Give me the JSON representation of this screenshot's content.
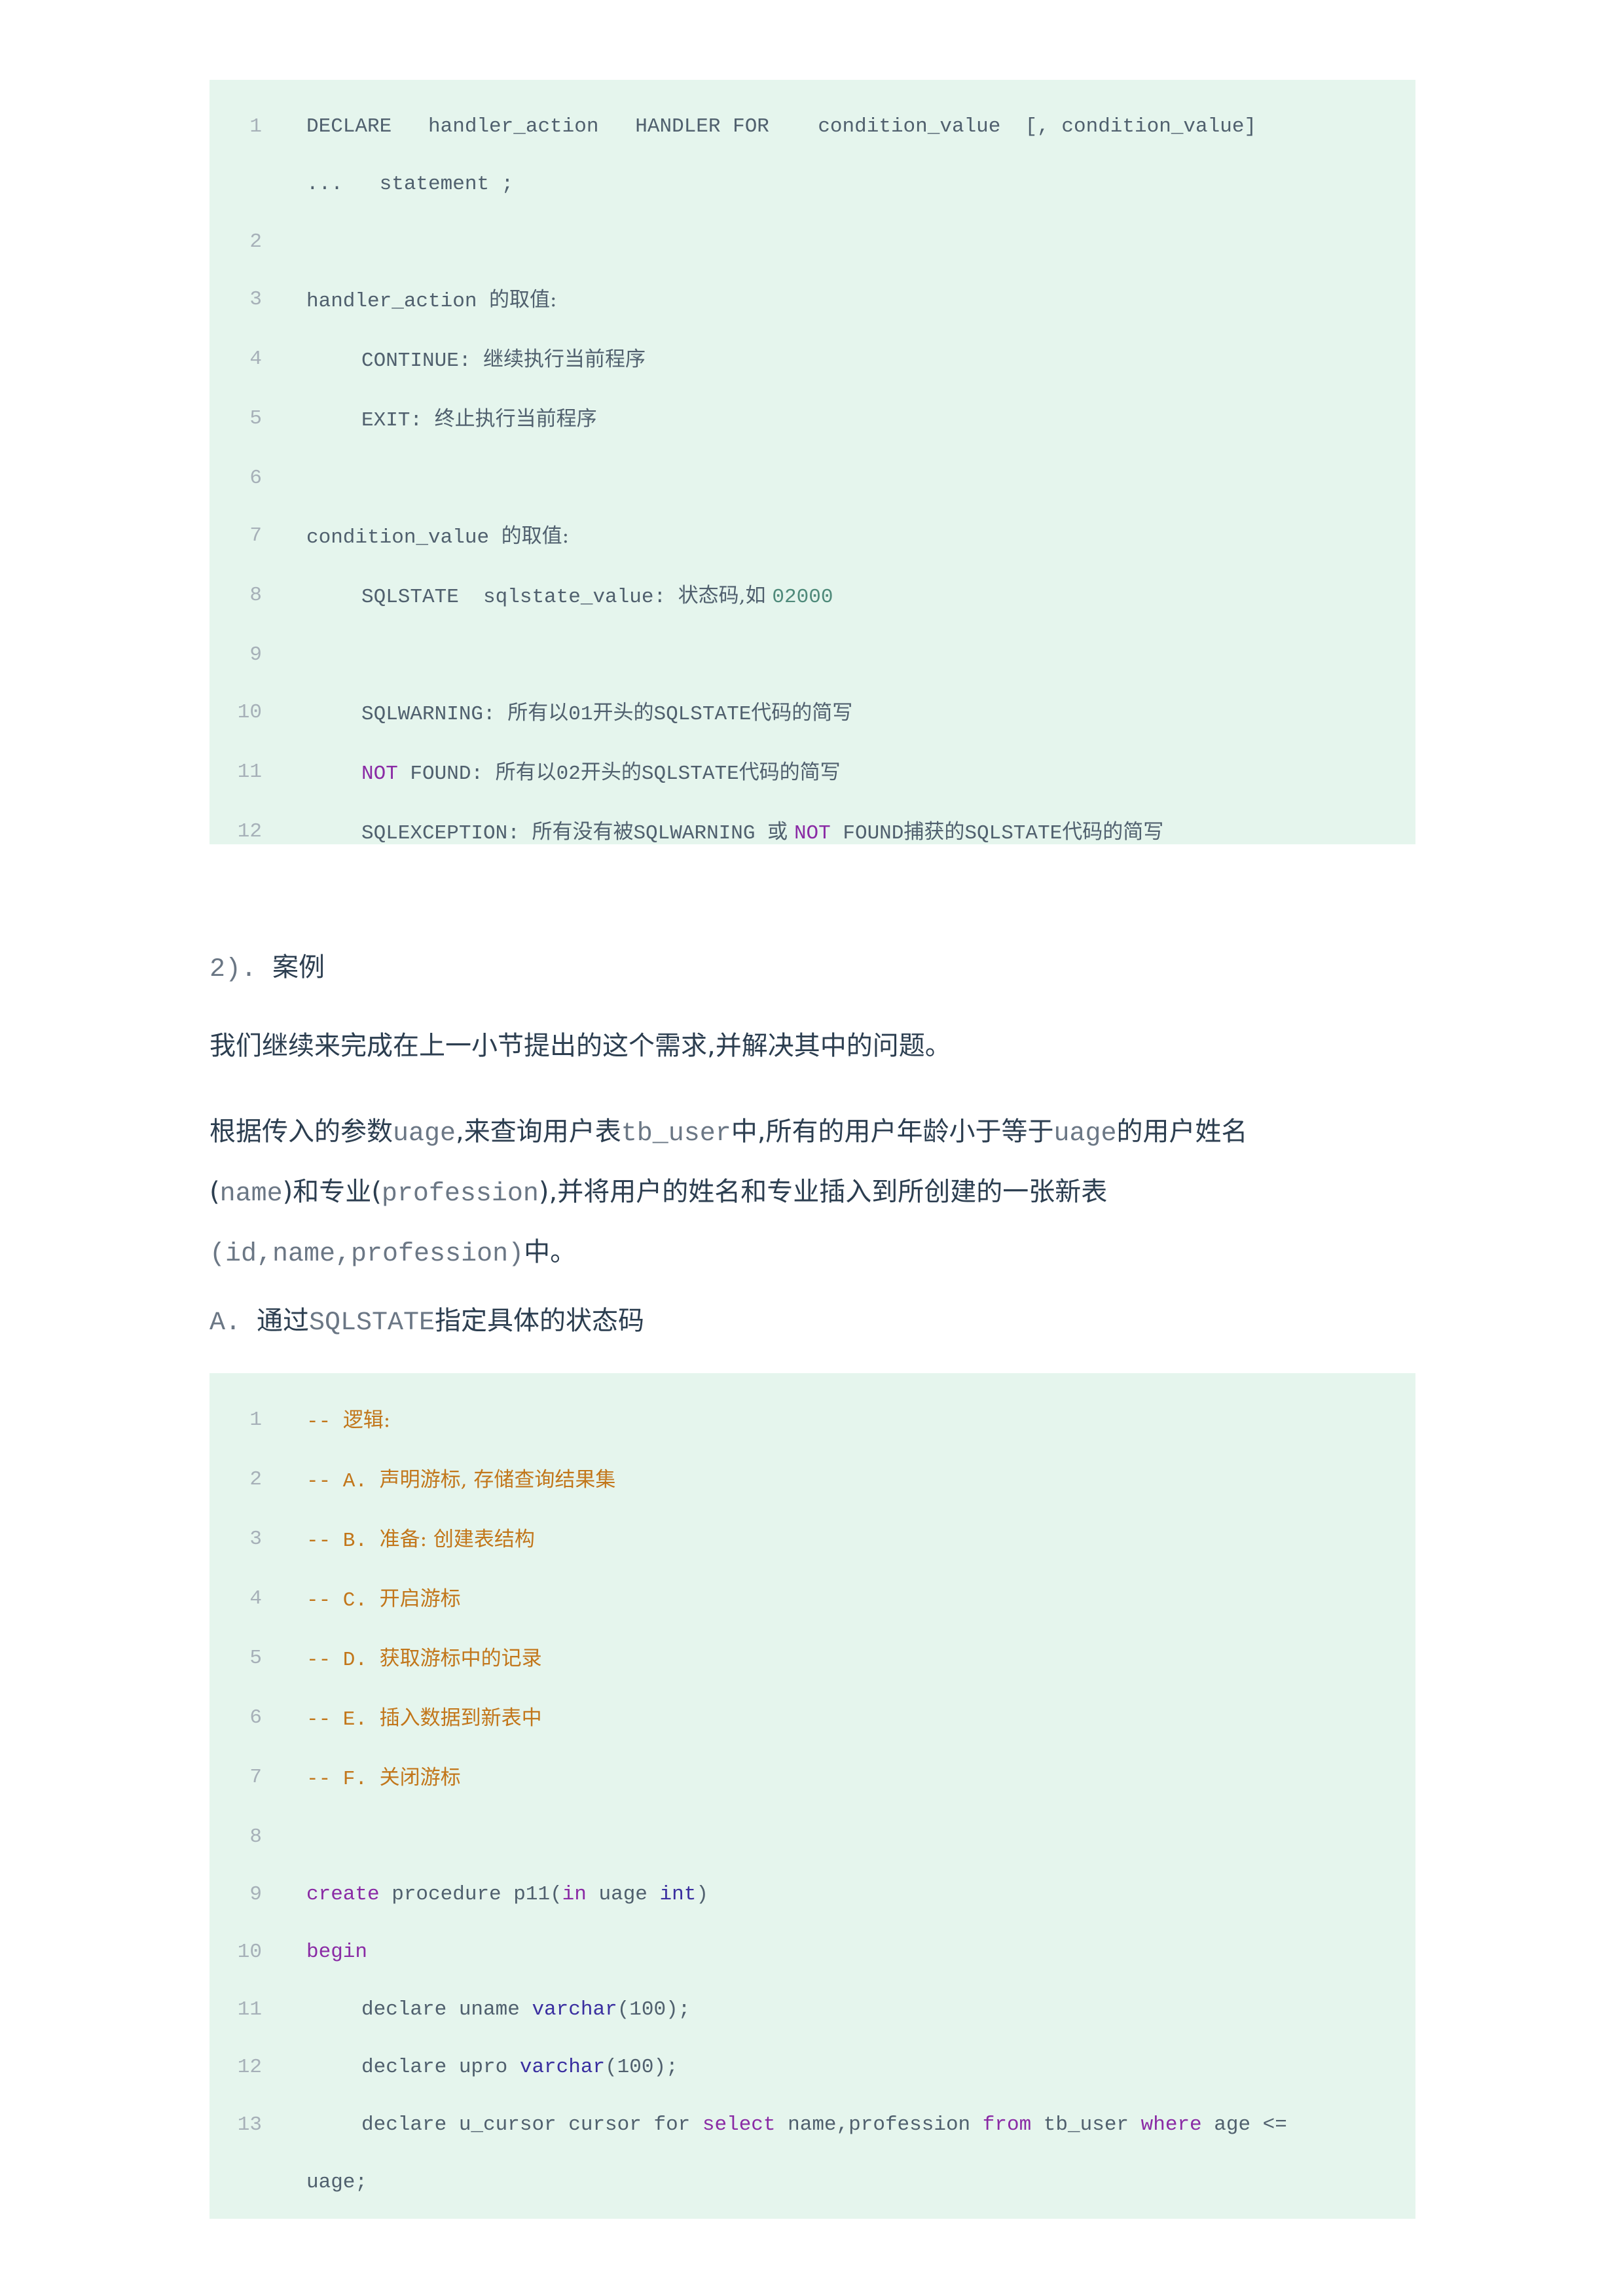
{
  "block1": {
    "lines": [
      {
        "n": "1",
        "parts": [
          {
            "t": "DECLARE   handler_action   HANDLER FOR    condition_value  [, condition_value]"
          }
        ],
        "cont": "...   statement ;"
      },
      {
        "n": "2",
        "parts": []
      },
      {
        "n": "3",
        "parts": [
          {
            "t": "handler_action "
          },
          {
            "t": "的取值:",
            "c": "cjk"
          }
        ]
      },
      {
        "n": "4",
        "indent": true,
        "parts": [
          {
            "t": "CONTINUE: "
          },
          {
            "t": "继续执行当前程序",
            "c": "cjk"
          }
        ]
      },
      {
        "n": "5",
        "indent": true,
        "parts": [
          {
            "t": "EXIT: "
          },
          {
            "t": "终止执行当前程序",
            "c": "cjk"
          }
        ]
      },
      {
        "n": "6",
        "parts": []
      },
      {
        "n": "7",
        "parts": [
          {
            "t": "condition_value "
          },
          {
            "t": "的取值:",
            "c": "cjk"
          }
        ]
      },
      {
        "n": "8",
        "indent": true,
        "parts": [
          {
            "t": "SQLSTATE  sqlstate_value: "
          },
          {
            "t": "状态码,如 ",
            "c": "cjk"
          },
          {
            "t": "02000",
            "c": "nm"
          }
        ]
      },
      {
        "n": "9",
        "parts": []
      },
      {
        "n": "10",
        "indent": true,
        "parts": [
          {
            "t": "SQLWARNING: "
          },
          {
            "t": "所有以",
            "c": "cjk"
          },
          {
            "t": "01"
          },
          {
            "t": "开头的",
            "c": "cjk"
          },
          {
            "t": "SQLSTATE"
          },
          {
            "t": "代码的简写",
            "c": "cjk"
          }
        ]
      },
      {
        "n": "11",
        "indent": true,
        "parts": [
          {
            "t": "NOT",
            "c": "kw"
          },
          {
            "t": " FOUND: "
          },
          {
            "t": "所有以",
            "c": "cjk"
          },
          {
            "t": "02"
          },
          {
            "t": "开头的",
            "c": "cjk"
          },
          {
            "t": "SQLSTATE"
          },
          {
            "t": "代码的简写",
            "c": "cjk"
          }
        ]
      },
      {
        "n": "12",
        "indent": true,
        "parts": [
          {
            "t": "SQLEXCEPTION: "
          },
          {
            "t": "所有没有被",
            "c": "cjk"
          },
          {
            "t": "SQLWARNING "
          },
          {
            "t": "或 ",
            "c": "cjk"
          },
          {
            "t": "NOT",
            "c": "kw"
          },
          {
            "t": " FOUND"
          },
          {
            "t": "捕获的",
            "c": "cjk"
          },
          {
            "t": "SQLSTATE"
          },
          {
            "t": "代码的简写",
            "c": "cjk"
          }
        ]
      }
    ]
  },
  "heading_case": {
    "num": "2). ",
    "text": "案例"
  },
  "intro": "我们继续来完成在上一小节提出的这个需求,并解决其中的问题。",
  "desc": [
    {
      "t": "根据传入的参数"
    },
    {
      "t": "uage",
      "m": true
    },
    {
      "t": ",来查询用户表"
    },
    {
      "t": "tb_user",
      "m": true
    },
    {
      "t": "中,所有的用户年龄小于等于"
    },
    {
      "t": "uage",
      "m": true
    },
    {
      "t": "的用户姓名"
    },
    {
      "t": "\n("
    },
    {
      "t": "name",
      "m": true
    },
    {
      "t": ")和专业("
    },
    {
      "t": "profession",
      "m": true
    },
    {
      "t": "),并将用户的姓名和专业插入到所创建的一张新表"
    },
    {
      "t": "\n"
    },
    {
      "t": "(id,name,profession)",
      "m": true
    },
    {
      "t": "中。"
    }
  ],
  "heading_a": {
    "num": "A. ",
    "pre": "通过",
    "code": "SQLSTATE",
    "post": "指定具体的状态码"
  },
  "block2": {
    "lines": [
      {
        "n": "1",
        "parts": [
          {
            "t": "-- ",
            "c": "cm"
          },
          {
            "t": "逻辑:",
            "c": "cm cjk"
          }
        ]
      },
      {
        "n": "2",
        "parts": [
          {
            "t": "-- A. ",
            "c": "cm"
          },
          {
            "t": "声明游标, 存储查询结果集",
            "c": "cm cjk"
          }
        ]
      },
      {
        "n": "3",
        "parts": [
          {
            "t": "-- B. ",
            "c": "cm"
          },
          {
            "t": "准备: 创建表结构",
            "c": "cm cjk"
          }
        ]
      },
      {
        "n": "4",
        "parts": [
          {
            "t": "-- C. ",
            "c": "cm"
          },
          {
            "t": "开启游标",
            "c": "cm cjk"
          }
        ]
      },
      {
        "n": "5",
        "parts": [
          {
            "t": "-- D. ",
            "c": "cm"
          },
          {
            "t": "获取游标中的记录",
            "c": "cm cjk"
          }
        ]
      },
      {
        "n": "6",
        "parts": [
          {
            "t": "-- E. ",
            "c": "cm"
          },
          {
            "t": "插入数据到新表中",
            "c": "cm cjk"
          }
        ]
      },
      {
        "n": "7",
        "parts": [
          {
            "t": "-- F. ",
            "c": "cm"
          },
          {
            "t": "关闭游标",
            "c": "cm cjk"
          }
        ]
      },
      {
        "n": "8",
        "parts": []
      },
      {
        "n": "9",
        "parts": [
          {
            "t": "create",
            "c": "kw"
          },
          {
            "t": " procedure p11("
          },
          {
            "t": "in",
            "c": "kw"
          },
          {
            "t": " uage "
          },
          {
            "t": "int",
            "c": "ty"
          },
          {
            "t": ")"
          }
        ]
      },
      {
        "n": "10",
        "parts": [
          {
            "t": "begin",
            "c": "kw"
          }
        ]
      },
      {
        "n": "11",
        "indent": true,
        "parts": [
          {
            "t": "declare uname "
          },
          {
            "t": "varchar",
            "c": "ty"
          },
          {
            "t": "(100);"
          }
        ]
      },
      {
        "n": "12",
        "indent": true,
        "parts": [
          {
            "t": "declare upro "
          },
          {
            "t": "varchar",
            "c": "ty"
          },
          {
            "t": "(100);"
          }
        ]
      },
      {
        "n": "13",
        "indent": true,
        "parts": [
          {
            "t": "declare u_cursor cursor for "
          },
          {
            "t": "select",
            "c": "kw"
          },
          {
            "t": " name,profession "
          },
          {
            "t": "from",
            "c": "kw"
          },
          {
            "t": " tb_user "
          },
          {
            "t": "where",
            "c": "kw"
          },
          {
            "t": " age <="
          }
        ],
        "cont": "uage;"
      }
    ]
  }
}
